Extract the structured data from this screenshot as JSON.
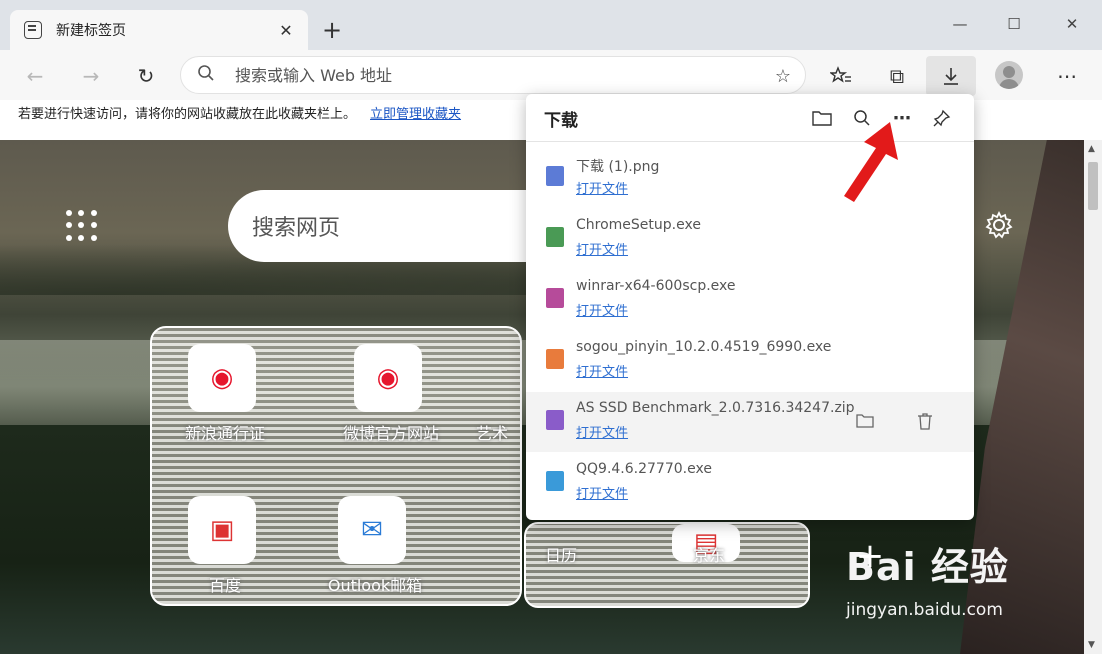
{
  "tab": {
    "title": "新建标签页",
    "close": "✕"
  },
  "new_tab": "+",
  "window": {
    "minimize": "—",
    "maximize": "☐",
    "close": "✕"
  },
  "toolbar": {
    "back": "←",
    "forward": "→",
    "refresh": "↻",
    "address_placeholder": "搜索或输入 Web 地址",
    "favorites": "☆",
    "collections": "⧉",
    "download": "⤓",
    "more": "⋯"
  },
  "favorites_bar": {
    "text": "若要进行快速访问，请将你的网站收藏放在此收藏夹栏上。",
    "link": "立即管理收藏夹"
  },
  "newtab": {
    "search_placeholder": "搜索网页",
    "tiles_row1": [
      {
        "label": "新浪通行证",
        "icon": "weibo-icon",
        "color": "#e6162d"
      },
      {
        "label": "微博官方网站",
        "icon": "weibo-icon",
        "color": "#e6162d"
      },
      {
        "label": "艺术",
        "icon": "app-icon",
        "color": "#c44"
      }
    ],
    "tiles_row2": [
      {
        "label": "百度",
        "icon": "baidu-icon",
        "color": "#d33"
      },
      {
        "label": "Outlook邮箱",
        "icon": "outlook-icon",
        "color": "#2a7bd6"
      },
      {
        "label": "日历",
        "icon": "app-icon",
        "color": "#c23c9a"
      },
      {
        "label": "京东",
        "icon": "app-icon",
        "color": "#d33"
      }
    ],
    "add": "+"
  },
  "downloads": {
    "title": "下载",
    "items": [
      {
        "name": "下载 (1).png",
        "action": "打开文件",
        "color": "#5c7bd6"
      },
      {
        "name": "ChromeSetup.exe",
        "action": "打开文件",
        "color": "#4a9a55"
      },
      {
        "name": "winrar-x64-600scp.exe",
        "action": "打开文件",
        "color": "#b64b9a"
      },
      {
        "name": "sogou_pinyin_10.2.0.4519_6990.exe",
        "action": "打开文件",
        "color": "#e87b3c"
      },
      {
        "name": "AS SSD Benchmark_2.0.7316.34247.zip",
        "action": "打开文件",
        "color": "#8a5cc9"
      },
      {
        "name": "QQ9.4.6.27770.exe",
        "action": "打开文件",
        "color": "#3a9ad9"
      }
    ]
  },
  "watermark": {
    "logo": "Bai 经验",
    "url": "jingyan.baidu.com"
  }
}
